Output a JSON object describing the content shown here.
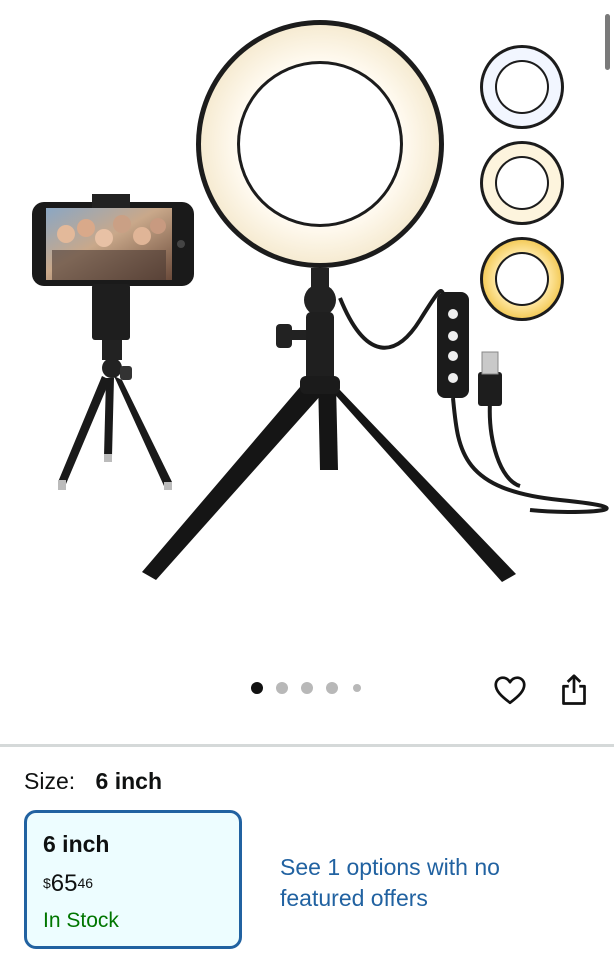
{
  "gallery": {
    "image_count": 5,
    "active_index": 0
  },
  "actions": {
    "favorite_icon": "heart-icon",
    "share_icon": "share-icon"
  },
  "variation": {
    "label": "Size:",
    "selected_value": "6 inch",
    "options": [
      {
        "name": "6 inch",
        "price_symbol": "$",
        "price_whole": "65",
        "price_fraction": "46",
        "availability": "In Stock"
      }
    ],
    "other_options_text": "See 1 options with no featured offers"
  },
  "colors": {
    "link": "#2162a1",
    "in_stock": "#007600",
    "selected_border": "#2162a1",
    "selected_background": "#edfdff"
  }
}
